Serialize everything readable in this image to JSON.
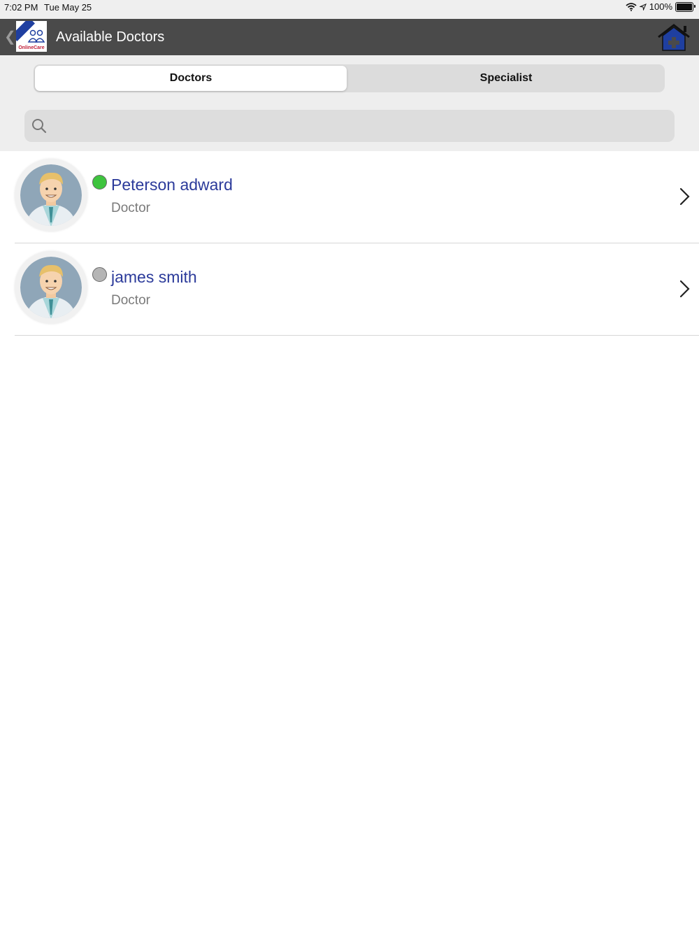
{
  "status_bar": {
    "time": "7:02 PM",
    "date": "Tue May 25",
    "battery": "100%"
  },
  "header": {
    "title": "Available Doctors",
    "logo_text": "OnlineCare"
  },
  "tabs": [
    {
      "label": "Doctors",
      "selected": true
    },
    {
      "label": "Specialist",
      "selected": false
    }
  ],
  "search": {
    "placeholder": "",
    "value": ""
  },
  "doctors": [
    {
      "name": "Peterson adward",
      "role": "Doctor",
      "status_color": "#3ec43e"
    },
    {
      "name": "james smith",
      "role": "Doctor",
      "status_color": "#b5b5b5"
    }
  ],
  "colors": {
    "nav_bg": "#4a4a4a",
    "name_text": "#2b3a9a",
    "online": "#3ec43e",
    "offline": "#b5b5b5",
    "home_icon": "#1f3fa0"
  }
}
